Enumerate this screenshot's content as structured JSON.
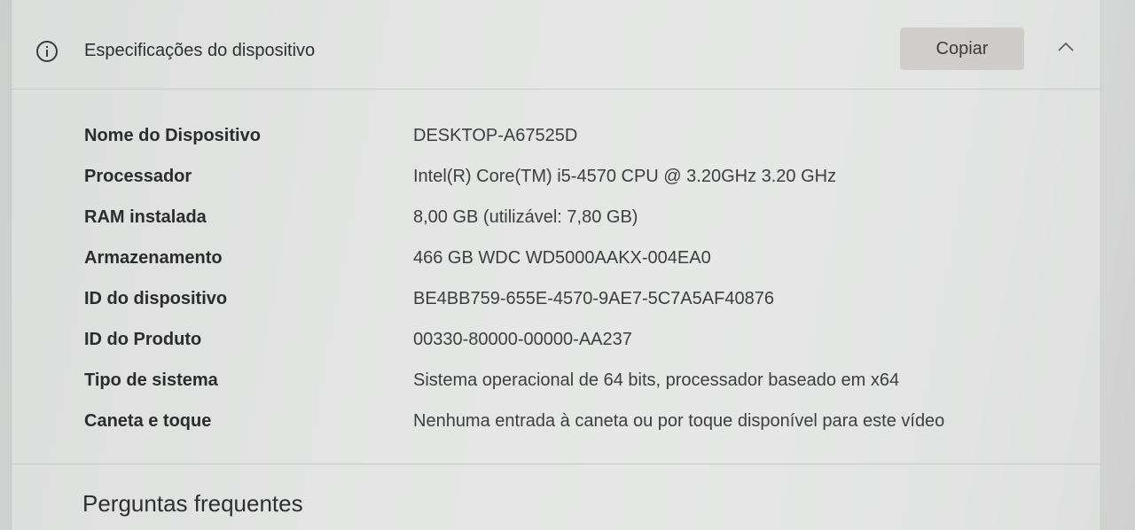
{
  "section": {
    "icon": "info-icon",
    "title": "Especificações do dispositivo",
    "copy_label": "Copiar",
    "collapse_icon": "chevron-up-icon"
  },
  "specs": [
    {
      "label": "Nome do Dispositivo",
      "value": "DESKTOP-A67525D"
    },
    {
      "label": "Processador",
      "value": "Intel(R) Core(TM) i5-4570 CPU @ 3.20GHz   3.20 GHz"
    },
    {
      "label": "RAM instalada",
      "value": "8,00 GB (utilizável: 7,80 GB)"
    },
    {
      "label": "Armazenamento",
      "value": "466 GB WDC WD5000AAKX-004EA0"
    },
    {
      "label": "ID do dispositivo",
      "value": "BE4BB759-655E-4570-9AE7-5C7A5AF40876"
    },
    {
      "label": "ID do Produto",
      "value": "00330-80000-00000-AA237"
    },
    {
      "label": "Tipo de sistema",
      "value": "Sistema operacional de 64 bits, processador baseado em x64"
    },
    {
      "label": "Caneta e toque",
      "value": "Nenhuma entrada à caneta ou por toque disponível para este vídeo"
    }
  ],
  "faq": {
    "title": "Perguntas frequentes"
  }
}
